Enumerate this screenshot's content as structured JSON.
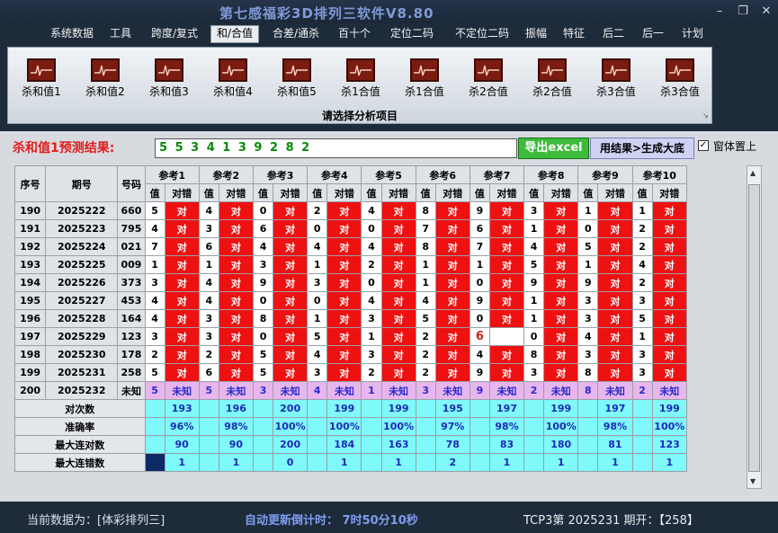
{
  "window": {
    "title": "第七感福彩3D排列三软件V8.80"
  },
  "menu": [
    {
      "label": "系统数据"
    },
    {
      "label": "工具"
    },
    {
      "label": "跨度/复式"
    },
    {
      "label": "和/合值",
      "active": true
    },
    {
      "label": "合差/通杀"
    },
    {
      "label": "百十个"
    },
    {
      "label": "定位二码"
    },
    {
      "label": "不定位二码"
    },
    {
      "label": "振幅"
    },
    {
      "label": "特征"
    },
    {
      "label": "后二"
    },
    {
      "label": "后一"
    },
    {
      "label": "计划"
    }
  ],
  "toolbar": {
    "items": [
      "杀和值1",
      "杀和值2",
      "杀和值3",
      "杀和值4",
      "杀和值5",
      "杀1合值",
      "杀1合值",
      "杀2合值",
      "杀2合值",
      "杀3合值",
      "杀3合值"
    ],
    "caption": "请选择分析项目"
  },
  "prediction": {
    "label": "杀和值1预测结果:",
    "value": "5 5 3 4 1 3 9 2 8 2",
    "export_button": "导出excel",
    "generate_button": "用结果>生成大底",
    "on_top_checked": true,
    "on_top_label": "窗体置上"
  },
  "table": {
    "headers": {
      "seq": "序号",
      "issue": "期号",
      "code": "号码",
      "val": "值",
      "judge": "对错"
    },
    "refs": [
      "参考1",
      "参考2",
      "参考3",
      "参考4",
      "参考5",
      "参考6",
      "参考7",
      "参考8",
      "参考9",
      "参考10"
    ],
    "rows": [
      {
        "seq": "190",
        "issue": "2025222",
        "code": "660",
        "refs": [
          [
            "5",
            "对"
          ],
          [
            "4",
            "对"
          ],
          [
            "0",
            "对"
          ],
          [
            "2",
            "对"
          ],
          [
            "4",
            "对"
          ],
          [
            "8",
            "对"
          ],
          [
            "9",
            "对"
          ],
          [
            "3",
            "对"
          ],
          [
            "1",
            "对"
          ],
          [
            "1",
            "对"
          ]
        ]
      },
      {
        "seq": "191",
        "issue": "2025223",
        "code": "795",
        "refs": [
          [
            "4",
            "对"
          ],
          [
            "3",
            "对"
          ],
          [
            "6",
            "对"
          ],
          [
            "0",
            "对"
          ],
          [
            "0",
            "对"
          ],
          [
            "7",
            "对"
          ],
          [
            "6",
            "对"
          ],
          [
            "1",
            "对"
          ],
          [
            "0",
            "对"
          ],
          [
            "2",
            "对"
          ]
        ]
      },
      {
        "seq": "192",
        "issue": "2025224",
        "code": "021",
        "refs": [
          [
            "7",
            "对"
          ],
          [
            "6",
            "对"
          ],
          [
            "4",
            "对"
          ],
          [
            "4",
            "对"
          ],
          [
            "4",
            "对"
          ],
          [
            "8",
            "对"
          ],
          [
            "7",
            "对"
          ],
          [
            "4",
            "对"
          ],
          [
            "5",
            "对"
          ],
          [
            "2",
            "对"
          ]
        ]
      },
      {
        "seq": "193",
        "issue": "2025225",
        "code": "009",
        "refs": [
          [
            "1",
            "对"
          ],
          [
            "1",
            "对"
          ],
          [
            "3",
            "对"
          ],
          [
            "1",
            "对"
          ],
          [
            "2",
            "对"
          ],
          [
            "1",
            "对"
          ],
          [
            "1",
            "对"
          ],
          [
            "5",
            "对"
          ],
          [
            "1",
            "对"
          ],
          [
            "4",
            "对"
          ]
        ]
      },
      {
        "seq": "194",
        "issue": "2025226",
        "code": "373",
        "refs": [
          [
            "3",
            "对"
          ],
          [
            "4",
            "对"
          ],
          [
            "9",
            "对"
          ],
          [
            "3",
            "对"
          ],
          [
            "0",
            "对"
          ],
          [
            "1",
            "对"
          ],
          [
            "0",
            "对"
          ],
          [
            "9",
            "对"
          ],
          [
            "9",
            "对"
          ],
          [
            "2",
            "对"
          ]
        ]
      },
      {
        "seq": "195",
        "issue": "2025227",
        "code": "453",
        "refs": [
          [
            "4",
            "对"
          ],
          [
            "4",
            "对"
          ],
          [
            "0",
            "对"
          ],
          [
            "0",
            "对"
          ],
          [
            "4",
            "对"
          ],
          [
            "4",
            "对"
          ],
          [
            "9",
            "对"
          ],
          [
            "1",
            "对"
          ],
          [
            "3",
            "对"
          ],
          [
            "3",
            "对"
          ]
        ]
      },
      {
        "seq": "196",
        "issue": "2025228",
        "code": "164",
        "refs": [
          [
            "4",
            "对"
          ],
          [
            "3",
            "对"
          ],
          [
            "8",
            "对"
          ],
          [
            "1",
            "对"
          ],
          [
            "3",
            "对"
          ],
          [
            "5",
            "对"
          ],
          [
            "0",
            "对"
          ],
          [
            "1",
            "对"
          ],
          [
            "3",
            "对"
          ],
          [
            "5",
            "对"
          ]
        ]
      },
      {
        "seq": "197",
        "issue": "2025229",
        "code": "123",
        "refs": [
          [
            "3",
            "对"
          ],
          [
            "3",
            "对"
          ],
          [
            "0",
            "对"
          ],
          [
            "5",
            "对"
          ],
          [
            "1",
            "对"
          ],
          [
            "2",
            "对"
          ],
          [
            "6",
            ""
          ],
          [
            "0",
            "对"
          ],
          [
            "4",
            "对"
          ],
          [
            "1",
            "对"
          ]
        ]
      },
      {
        "seq": "198",
        "issue": "2025230",
        "code": "178",
        "refs": [
          [
            "2",
            "对"
          ],
          [
            "2",
            "对"
          ],
          [
            "5",
            "对"
          ],
          [
            "4",
            "对"
          ],
          [
            "3",
            "对"
          ],
          [
            "2",
            "对"
          ],
          [
            "4",
            "对"
          ],
          [
            "8",
            "对"
          ],
          [
            "3",
            "对"
          ],
          [
            "3",
            "对"
          ]
        ]
      },
      {
        "seq": "199",
        "issue": "2025231",
        "code": "258",
        "refs": [
          [
            "5",
            "对"
          ],
          [
            "6",
            "对"
          ],
          [
            "5",
            "对"
          ],
          [
            "3",
            "对"
          ],
          [
            "2",
            "对"
          ],
          [
            "2",
            "对"
          ],
          [
            "9",
            "对"
          ],
          [
            "3",
            "对"
          ],
          [
            "8",
            "对"
          ],
          [
            "3",
            "对"
          ]
        ]
      }
    ],
    "last_row": {
      "seq": "200",
      "issue": "2025232",
      "code": "未知",
      "vals": [
        "5",
        "5",
        "3",
        "4",
        "1",
        "3",
        "9",
        "2",
        "8",
        "2"
      ],
      "unknown": "未知"
    },
    "stats": [
      {
        "label": "对次数",
        "values": [
          "193",
          "196",
          "200",
          "199",
          "199",
          "195",
          "197",
          "199",
          "197",
          "199"
        ]
      },
      {
        "label": "准确率",
        "values": [
          "96%",
          "98%",
          "100%",
          "100%",
          "100%",
          "97%",
          "98%",
          "100%",
          "98%",
          "100%"
        ]
      },
      {
        "label": "最大连对数",
        "values": [
          "90",
          "90",
          "200",
          "184",
          "163",
          "78",
          "83",
          "180",
          "81",
          "123"
        ]
      },
      {
        "label": "最大连错数",
        "values": [
          "1",
          "1",
          "0",
          "1",
          "1",
          "2",
          "1",
          "1",
          "1",
          "1"
        ]
      }
    ]
  },
  "status": {
    "current_data": "当前数据为：[体彩排列三]",
    "countdown": "自动更新倒计时： 7时50分10秒",
    "issue_info": "TCP3第 2025231 期开：【258】"
  },
  "colors": {
    "correct": "#ee1111",
    "stats_bg": "#7ff9f9",
    "last_row_bg": "#e7b6ec",
    "prediction_text": "#0a8a0a",
    "title": "#7e9ad8"
  }
}
